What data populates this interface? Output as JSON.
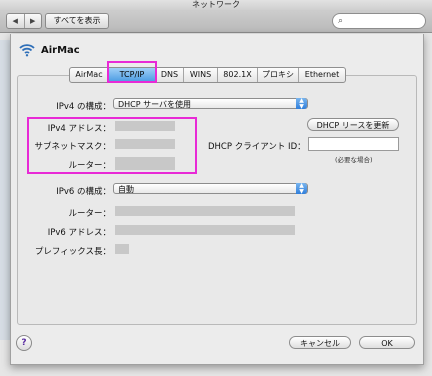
{
  "window": {
    "title": "ネットワーク"
  },
  "toolbar": {
    "back_icon": "back-arrow-icon",
    "forward_icon": "forward-arrow-icon",
    "show_all_label": "すべてを表示",
    "search_placeholder": ""
  },
  "sheet": {
    "title": "AirMac",
    "wifi_icon": "wifi-icon",
    "tabs": [
      {
        "label": "AirMac",
        "active": false
      },
      {
        "label": "TCP/IP",
        "active": true
      },
      {
        "label": "DNS",
        "active": false
      },
      {
        "label": "WINS",
        "active": false
      },
      {
        "label": "802.1X",
        "active": false
      },
      {
        "label": "プロキシ",
        "active": false
      },
      {
        "label": "Ethernet",
        "active": false
      }
    ],
    "ipv4": {
      "config_label": "IPv4 の構成：",
      "config_value": "DHCP サーバを使用",
      "address_label": "IPv4 アドレス：",
      "subnet_label": "サブネットマスク：",
      "router_label": "ルーター：",
      "renew_button": "DHCP リースを更新",
      "client_id_label": "DHCP クライアント ID：",
      "client_id_value": "",
      "client_id_note": "(必要な場合)"
    },
    "ipv6": {
      "config_label": "IPv6 の構成：",
      "config_value": "自動",
      "router_label": "ルーター：",
      "address_label": "IPv6 アドレス：",
      "prefix_label": "プレフィックス長："
    },
    "buttons": {
      "cancel": "キャンセル",
      "ok": "OK",
      "help": "?"
    }
  },
  "colors": {
    "highlight": "#e82ad6",
    "accent": "#4a9ae2"
  }
}
